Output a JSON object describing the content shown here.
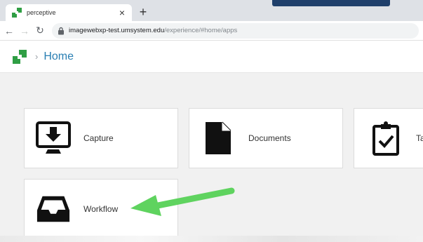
{
  "browser": {
    "tab_title": "perceptive",
    "tab_close_glyph": "×",
    "new_tab_glyph": "+",
    "back_glyph": "←",
    "forward_glyph": "→",
    "reload_glyph": "↻",
    "url_host": "imagewebxp-test.umsystem.edu",
    "url_path": "/experience/#home/apps"
  },
  "header": {
    "separator": "›",
    "title": "Home"
  },
  "tiles": [
    {
      "label": "Capture",
      "icon": "capture-icon"
    },
    {
      "label": "Documents",
      "icon": "documents-icon"
    },
    {
      "label": "Ta",
      "icon": "tasks-icon"
    },
    {
      "label": "Workflow",
      "icon": "workflow-icon"
    }
  ],
  "colors": {
    "accent": "#2a7fb3",
    "logo_green": "#2f9e44",
    "arrow_green": "#5fd35f",
    "tab_strip": "#dee1e6",
    "content_bg": "#f1f1f1"
  }
}
